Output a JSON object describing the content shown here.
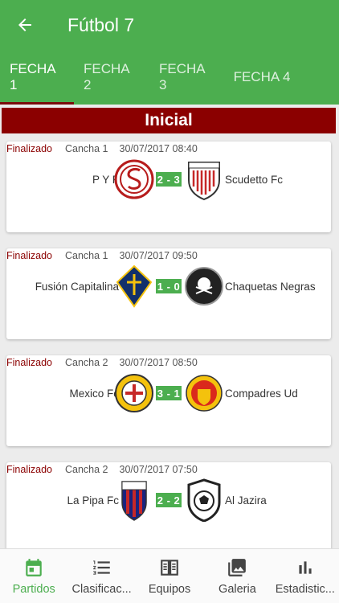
{
  "header": {
    "title": "Fútbol 7"
  },
  "tabs": [
    {
      "label": "FECHA 1",
      "active": true
    },
    {
      "label": "FECHA 2",
      "active": false
    },
    {
      "label": "FECHA 3",
      "active": false
    },
    {
      "label": "FECHA 4",
      "active": false
    }
  ],
  "section_title": "Inicial",
  "matches": [
    {
      "status": "Finalizado",
      "field": "Cancha 1",
      "datetime": "30/07/2017 08:40",
      "home": "P Y F",
      "away": "Scudetto Fc",
      "score": "2 - 3",
      "home_logo": "sevilla-crest-icon",
      "away_logo": "athletic-club-crest-icon"
    },
    {
      "status": "Finalizado",
      "field": "Cancha 1",
      "datetime": "30/07/2017 09:50",
      "home": "Fusión Capitalina",
      "away": "Chaquetas Negras",
      "score": "1 - 0",
      "home_logo": "aik-crest-icon",
      "away_logo": "orlando-pirates-crest-icon"
    },
    {
      "status": "Finalizado",
      "field": "Cancha 2",
      "datetime": "30/07/2017 08:50",
      "home": "Mexico Fc",
      "away": "Compadres Ud",
      "score": "3 - 1",
      "home_logo": "tarragona-crest-icon",
      "away_logo": "manchester-united-crest-icon"
    },
    {
      "status": "Finalizado",
      "field": "Cancha 2",
      "datetime": "30/07/2017 07:50",
      "home": "La Pipa Fc",
      "away": "Al Jazira",
      "score": "2 - 2",
      "home_logo": "bologna-crest-icon",
      "away_logo": "soccer-ball-shield-icon"
    }
  ],
  "bottom_nav": [
    {
      "label": "Partidos",
      "icon": "calendar-icon",
      "active": true
    },
    {
      "label": "Clasificac...",
      "icon": "ordered-list-icon",
      "active": false
    },
    {
      "label": "Equipos",
      "icon": "book-icon",
      "active": false
    },
    {
      "label": "Galeria",
      "icon": "gallery-icon",
      "active": false
    },
    {
      "label": "Estadistic...",
      "icon": "bar-chart-icon",
      "active": false
    }
  ],
  "colors": {
    "primary": "#4cae4f",
    "accent": "#8b0000"
  }
}
